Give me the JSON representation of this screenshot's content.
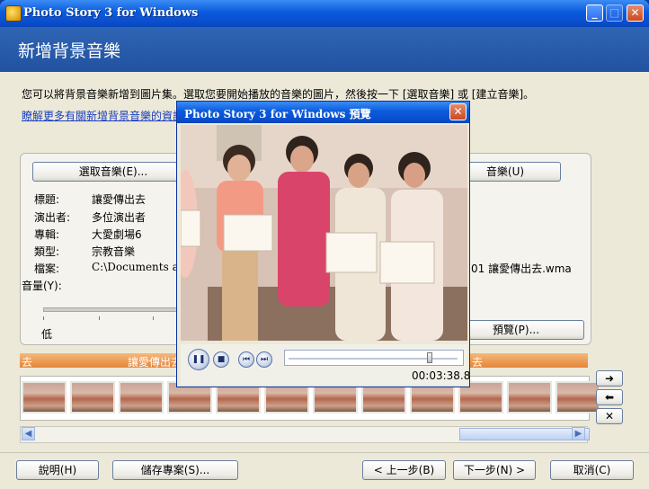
{
  "window": {
    "title": "Photo Story 3 for Windows",
    "minimize": "_",
    "maximize": "□",
    "close": "✕"
  },
  "page": {
    "title": "新增背景音樂",
    "instruction": "您可以將背景音樂新增到圖片集。選取您要開始播放的音樂的圖片，然後按一下 [選取音樂] 或 [建立音樂]。",
    "learn_more": "瞭解更多有關新增背景音樂的資訊"
  },
  "music_buttons": {
    "select": "選取音樂(E)...",
    "create_tail": "音樂(U)"
  },
  "song": {
    "labels": {
      "title": "標題:",
      "artist": "演出者:",
      "album": "專輯:",
      "genre": "類型:",
      "file": "檔案:",
      "volume": "音量(Y):"
    },
    "values": {
      "title": "讓愛傳出去",
      "artist": "多位演出者",
      "album": "大愛劇場6",
      "genre": "宗教音樂",
      "file_left": "C:\\Documents and S",
      "file_right": "01 讓愛傳出去.wma"
    },
    "volume_low": "低"
  },
  "preview_button": "預覽(P)...",
  "timeline": {
    "left_text": "去",
    "mid_text": "讓愛傳出去",
    "right_text": "去",
    "thumbnail_count": 12
  },
  "side_buttons": {
    "right": "➜",
    "left": "⬅",
    "remove": "✕"
  },
  "footer": {
    "help": "說明(H)",
    "save": "儲存專案(S)...",
    "back": "< 上一步(B)",
    "next": "下一步(N) >",
    "cancel": "取消(C)"
  },
  "preview": {
    "title": "Photo Story 3 for Windows 預覽",
    "time": "00:03:38.8",
    "progress": 0.82,
    "pause": "❚❚",
    "stop": "■",
    "prev": "⏮",
    "next": "⏭"
  }
}
